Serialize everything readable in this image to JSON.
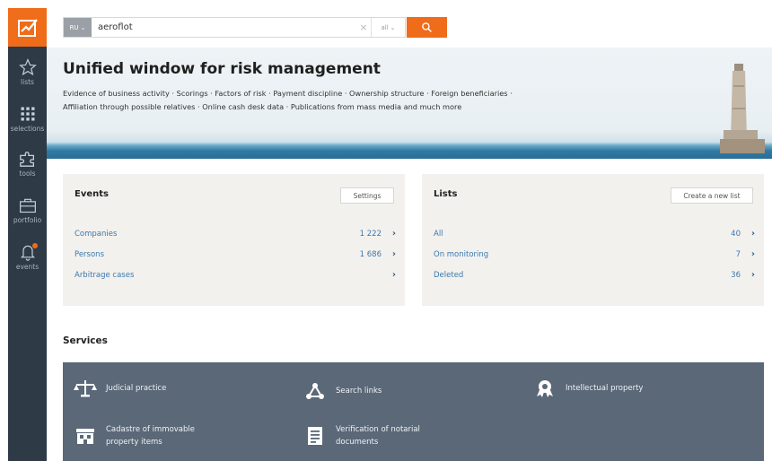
{
  "sidebar": {
    "items": [
      {
        "label": "lists",
        "icon": "star-icon"
      },
      {
        "label": "selections",
        "icon": "grid-icon"
      },
      {
        "label": "tools",
        "icon": "puzzle-icon"
      },
      {
        "label": "portfolio",
        "icon": "briefcase-icon"
      },
      {
        "label": "events",
        "icon": "bell-icon"
      }
    ],
    "accent": "#ef6c1a",
    "background": "#2e3a46"
  },
  "search": {
    "lang": "RU",
    "query": "aeroflot",
    "clear": "×",
    "scope": "all"
  },
  "hero": {
    "title": "Unified window for risk management",
    "line1": "Evidence of business activity · Scorings · Factors of risk · Payment discipline · Ownership structure · Foreign beneficiaries ·",
    "line2": "Affiliation through possible relatives · Online cash desk data · Publications from mass media and much more"
  },
  "events": {
    "title": "Events",
    "button": "Settings",
    "rows": [
      {
        "label": "Companies",
        "count": "1 222"
      },
      {
        "label": "Persons",
        "count": "1 686"
      },
      {
        "label": "Arbitrage cases",
        "count": ""
      }
    ]
  },
  "lists": {
    "title": "Lists",
    "button": "Create a new list",
    "rows": [
      {
        "label": "All",
        "count": "40"
      },
      {
        "label": "On monitoring",
        "count": "7"
      },
      {
        "label": "Deleted",
        "count": "36"
      }
    ]
  },
  "services": {
    "title": "Services",
    "items": [
      {
        "label": "Judicial practice",
        "icon": "scales-icon"
      },
      {
        "label": "Search links",
        "icon": "network-icon"
      },
      {
        "label": "Intellectual property",
        "icon": "award-icon"
      },
      {
        "label": "Cadastre of immovable property items",
        "icon": "building-icon"
      },
      {
        "label": "Verification of notarial documents",
        "icon": "document-icon"
      }
    ]
  }
}
